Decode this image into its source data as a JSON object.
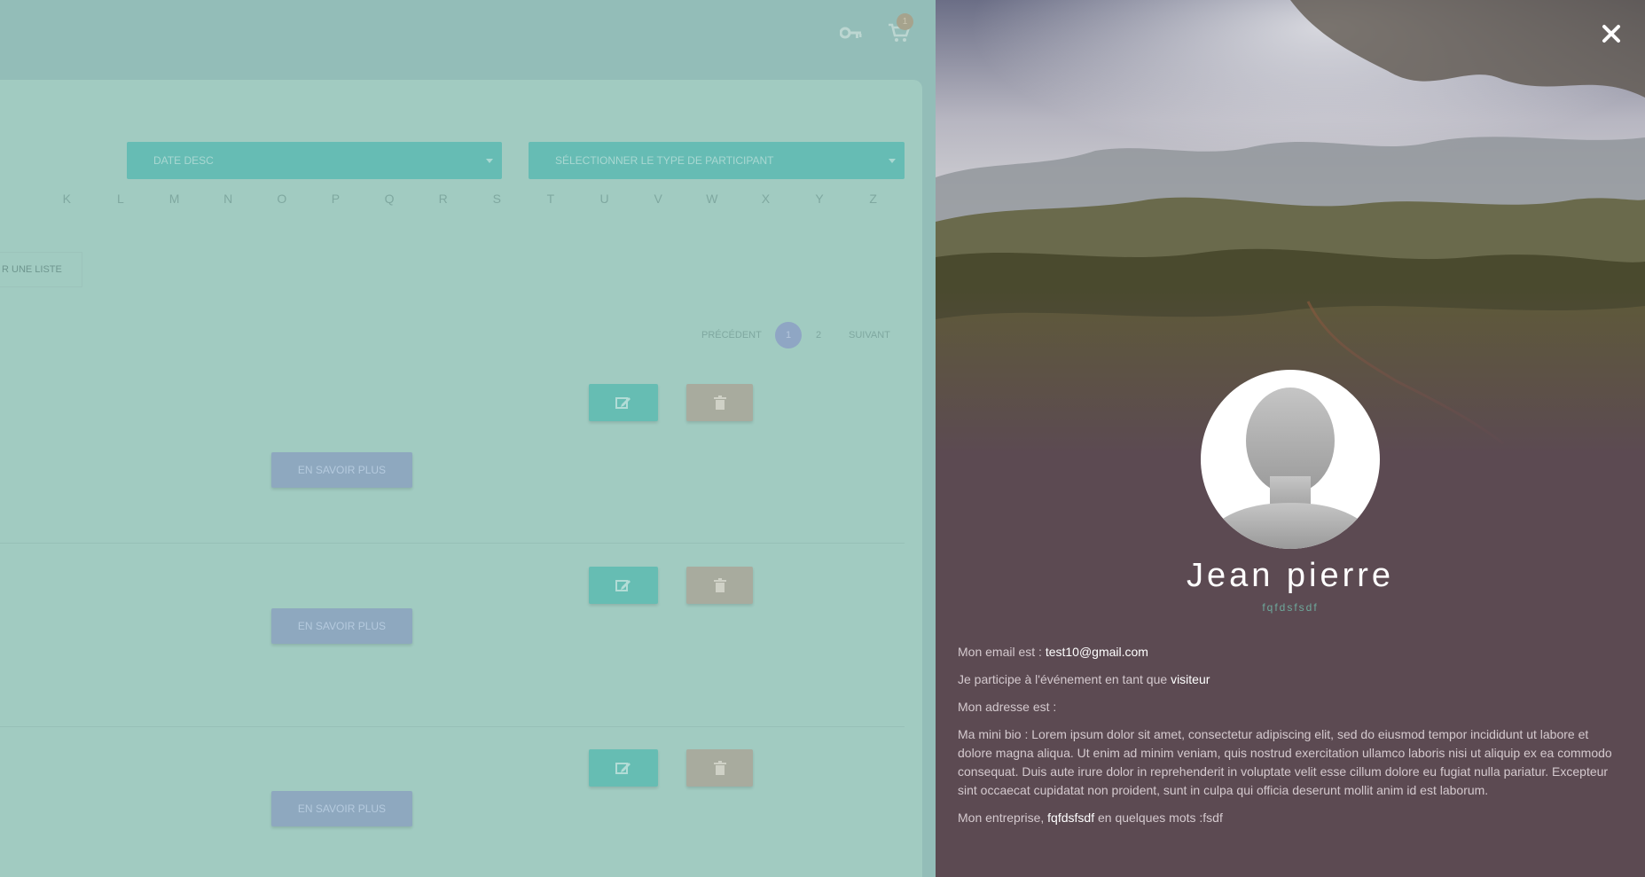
{
  "header": {
    "cart_count": "1"
  },
  "filters": {
    "sort_value": "DATE DESC",
    "type_placeholder": "SÉLECTIONNER LE TYPE DE PARTICIPANT"
  },
  "alphabet": [
    "K",
    "L",
    "M",
    "N",
    "O",
    "P",
    "Q",
    "R",
    "S",
    "T",
    "U",
    "V",
    "W",
    "X",
    "Y",
    "Z"
  ],
  "list_button_label": "R UNE LISTE",
  "pagination": {
    "prev": "PRÉCÉDENT",
    "pages": [
      "1",
      "2"
    ],
    "current": "1",
    "next": "SUIVANT"
  },
  "participants": [
    {
      "more_label": "EN SAVOIR PLUS"
    },
    {
      "more_label": "EN SAVOIR PLUS"
    },
    {
      "more_label": "EN SAVOIR PLUS"
    }
  ],
  "profile": {
    "name": "Jean pierre",
    "company_subtitle": "fqfdsfsdf",
    "email_label": "Mon email est : ",
    "email": "test10@gmail.com",
    "role_label": "Je participe à l'événement en tant que ",
    "role": "visiteur",
    "address_label": "Mon adresse est :",
    "bio": "Ma mini bio : Lorem ipsum dolor sit amet, consectetur adipiscing elit, sed do eiusmod tempor incididunt ut labore et dolore magna aliqua. Ut enim ad minim veniam, quis nostrud exercitation ullamco laboris nisi ut aliquip ex ea commodo consequat. Duis aute irure dolor in reprehenderit in voluptate velit esse cillum dolore eu fugiat nulla pariatur. Excepteur sint occaecat cupidatat non proident, sunt in culpa qui officia deserunt mollit anim id est laborum.",
    "company_label": "Mon entreprise, ",
    "company": "fqfdsfsdf",
    "company_words_label": " en quelques mots :",
    "company_words": "fsdf"
  },
  "icons": {
    "key": "key-icon",
    "cart": "cart-icon",
    "edit": "edit-icon",
    "delete": "trash-icon",
    "close": "close-icon",
    "avatar": "default-user-silhouette"
  },
  "colors": {
    "overlay_teal": "#93bdb8",
    "select_bg": "#66bcb4",
    "edit_bg": "#66bdb3",
    "delete_bg": "#a8ab9e",
    "more_bg": "#8ea8bf",
    "profile_bg": "#5c4a52",
    "accent_text": "#6ea89b"
  }
}
